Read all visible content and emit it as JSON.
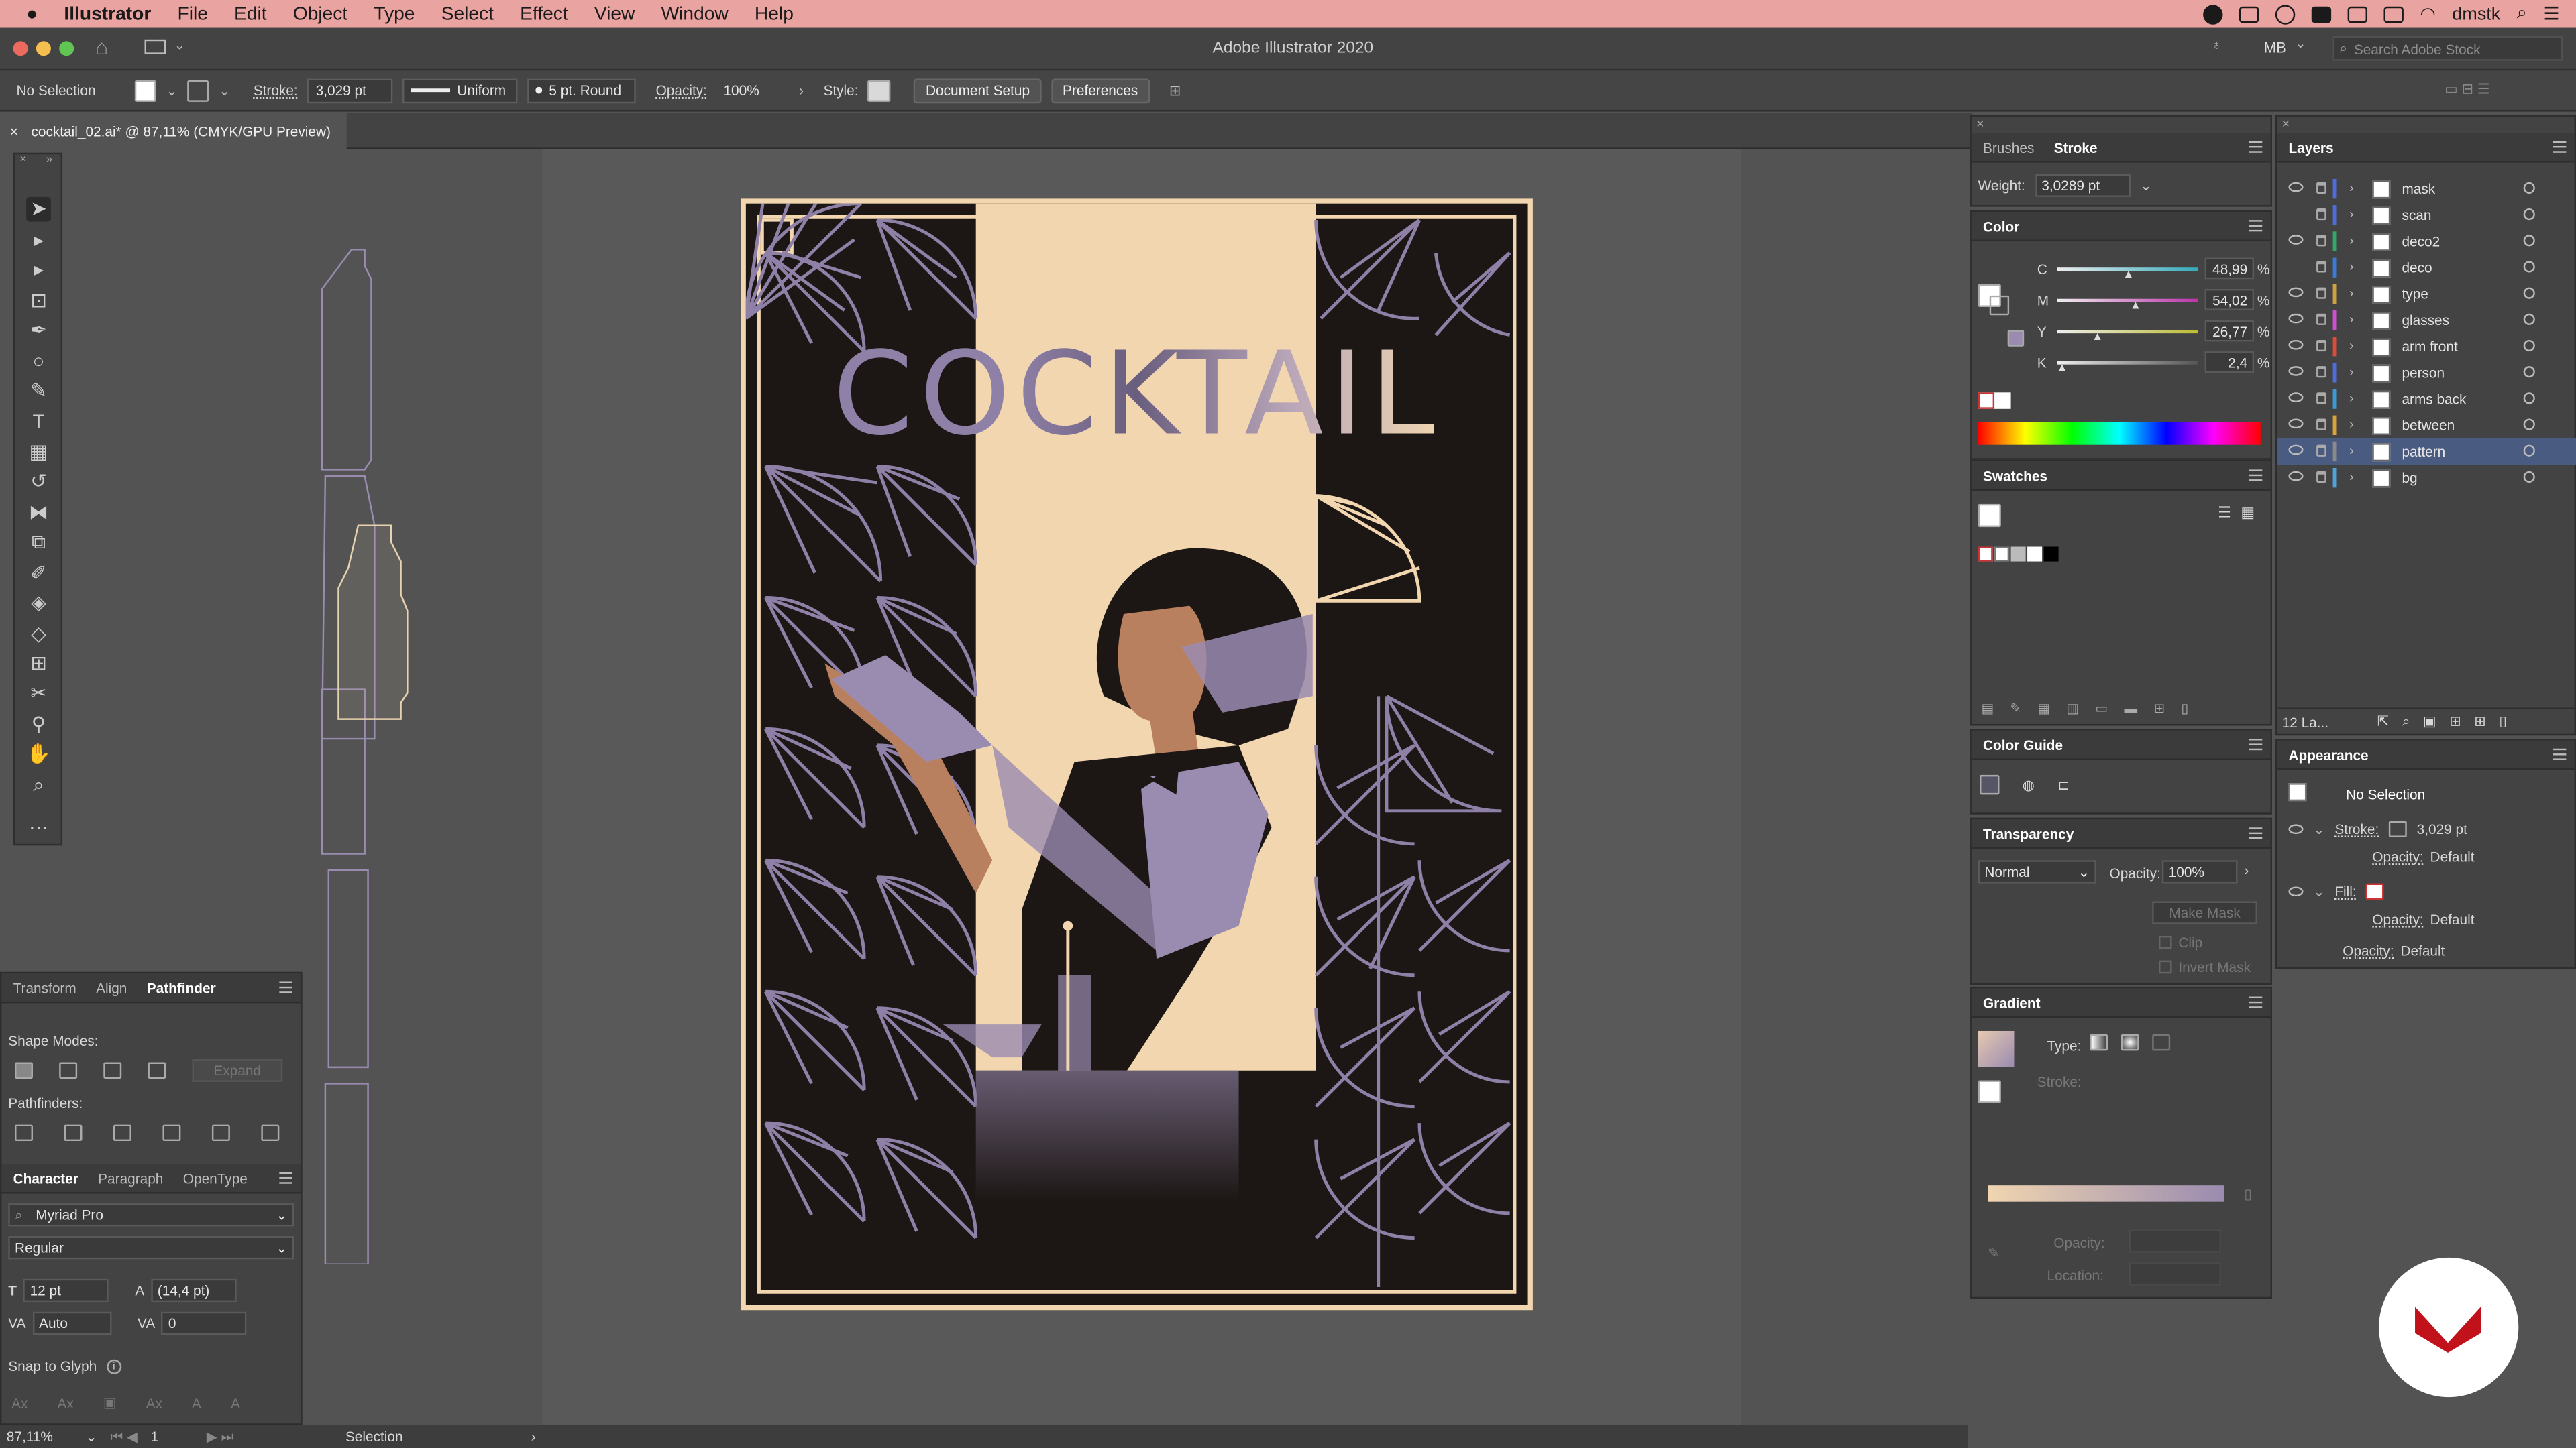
{
  "menubar": {
    "apple": "",
    "app": "Illustrator",
    "items": [
      "File",
      "Edit",
      "Object",
      "Type",
      "Select",
      "Effect",
      "View",
      "Window",
      "Help"
    ],
    "user": "dmstk"
  },
  "titlebar": {
    "title": "Adobe Illustrator 2020",
    "workspace": "MB",
    "search_placeholder": "Search Adobe Stock"
  },
  "control": {
    "selection": "No Selection",
    "stroke_label": "Stroke:",
    "stroke_value": "3,029 pt",
    "profile": "Uniform",
    "brush": "5 pt. Round",
    "opacity_label": "Opacity:",
    "opacity_value": "100%",
    "style_label": "Style:",
    "doc_setup": "Document Setup",
    "preferences": "Preferences"
  },
  "document": {
    "tab": "cocktail_02.ai* @ 87,11% (CMYK/GPU Preview)",
    "close": "×"
  },
  "artwork": {
    "title": "COCKTAIL"
  },
  "stroke_panel": {
    "tab1": "Brushes",
    "tab2": "Stroke",
    "weight_label": "Weight:",
    "weight_value": "3,0289 pt"
  },
  "color_panel": {
    "title": "Color",
    "channels": [
      {
        "k": "C",
        "v": "48,99",
        "pct": "%",
        "f": 0.49
      },
      {
        "k": "M",
        "v": "54,02",
        "pct": "%",
        "f": 0.54
      },
      {
        "k": "Y",
        "v": "26,77",
        "pct": "%",
        "f": 0.27
      },
      {
        "k": "K",
        "v": "2,4",
        "pct": "%",
        "f": 0.02
      }
    ]
  },
  "swatches": {
    "title": "Swatches"
  },
  "color_guide": {
    "title": "Color Guide"
  },
  "transparency": {
    "title": "Transparency",
    "mode": "Normal",
    "opacity_label": "Opacity:",
    "opacity_value": "100%",
    "make_mask": "Make Mask",
    "clip": "Clip",
    "invert": "Invert Mask"
  },
  "gradient": {
    "title": "Gradient",
    "type_label": "Type:",
    "stroke_label": "Stroke:",
    "opacity_label": "Opacity:",
    "location_label": "Location:"
  },
  "layers": {
    "title": "Layers",
    "count": "12 La...",
    "items": [
      {
        "name": "mask",
        "eye": true,
        "color": "#4f6dd9"
      },
      {
        "name": "scan",
        "eye": false,
        "color": "#4f6dd9"
      },
      {
        "name": "deco2",
        "eye": true,
        "color": "#33a86a"
      },
      {
        "name": "deco",
        "eye": false,
        "color": "#3b7bd6"
      },
      {
        "name": "type",
        "eye": true,
        "color": "#d0a23d"
      },
      {
        "name": "glasses",
        "eye": true,
        "color": "#d04fd0"
      },
      {
        "name": "arm front",
        "eye": true,
        "color": "#d94d3a"
      },
      {
        "name": "person",
        "eye": true,
        "color": "#4f6dd9"
      },
      {
        "name": "arms back",
        "eye": true,
        "color": "#3b9ad6"
      },
      {
        "name": "between",
        "eye": true,
        "color": "#d9a33b"
      },
      {
        "name": "pattern",
        "eye": true,
        "color": "#8a8a8a"
      },
      {
        "name": "bg",
        "eye": true,
        "color": "#4fa3d9"
      }
    ]
  },
  "appearance": {
    "title": "Appearance",
    "no_selection": "No Selection",
    "stroke_label": "Stroke:",
    "stroke_value": "3,029 pt",
    "opacity_label": "Opacity:",
    "opacity_value": "Default",
    "fill_label": "Fill:"
  },
  "left_panels": {
    "tabs": [
      "Transform",
      "Align",
      "Pathfinder"
    ],
    "shape_modes": "Shape Modes:",
    "expand": "Expand",
    "pathfinders": "Pathfinders:",
    "char_tabs": [
      "Character",
      "Paragraph",
      "OpenType"
    ],
    "font": "Myriad Pro",
    "style": "Regular",
    "size": "12 pt",
    "leading": "(14,4 pt)",
    "kerning": "Auto",
    "tracking": "0",
    "snap": "Snap to Glyph"
  },
  "status": {
    "zoom": "87,11%",
    "artboard": "1",
    "tool": "Selection"
  }
}
